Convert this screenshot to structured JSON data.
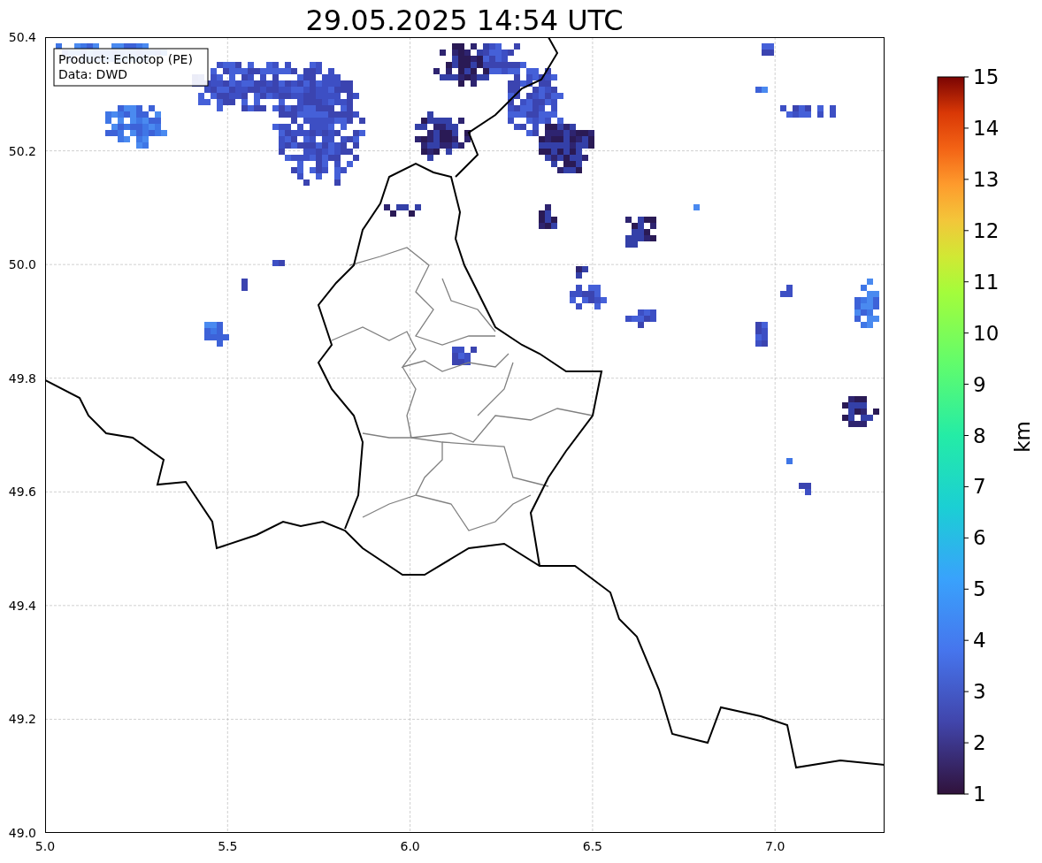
{
  "title": "29.05.2025 14:54 UTC",
  "info_box": [
    "Product: Echotop (PE)",
    "Data: DWD"
  ],
  "x_ticks": [
    "5.0",
    "5.5",
    "6.0",
    "6.5",
    "7.0"
  ],
  "y_ticks": [
    "50.4",
    "50.2",
    "50.0",
    "49.8",
    "49.6",
    "49.4",
    "49.2",
    "49.0"
  ],
  "colorbar": {
    "label": "km",
    "ticks": [
      "15",
      "14",
      "13",
      "12",
      "11",
      "10",
      "9",
      "8",
      "7",
      "6",
      "5",
      "4",
      "3",
      "2",
      "1"
    ]
  }
}
